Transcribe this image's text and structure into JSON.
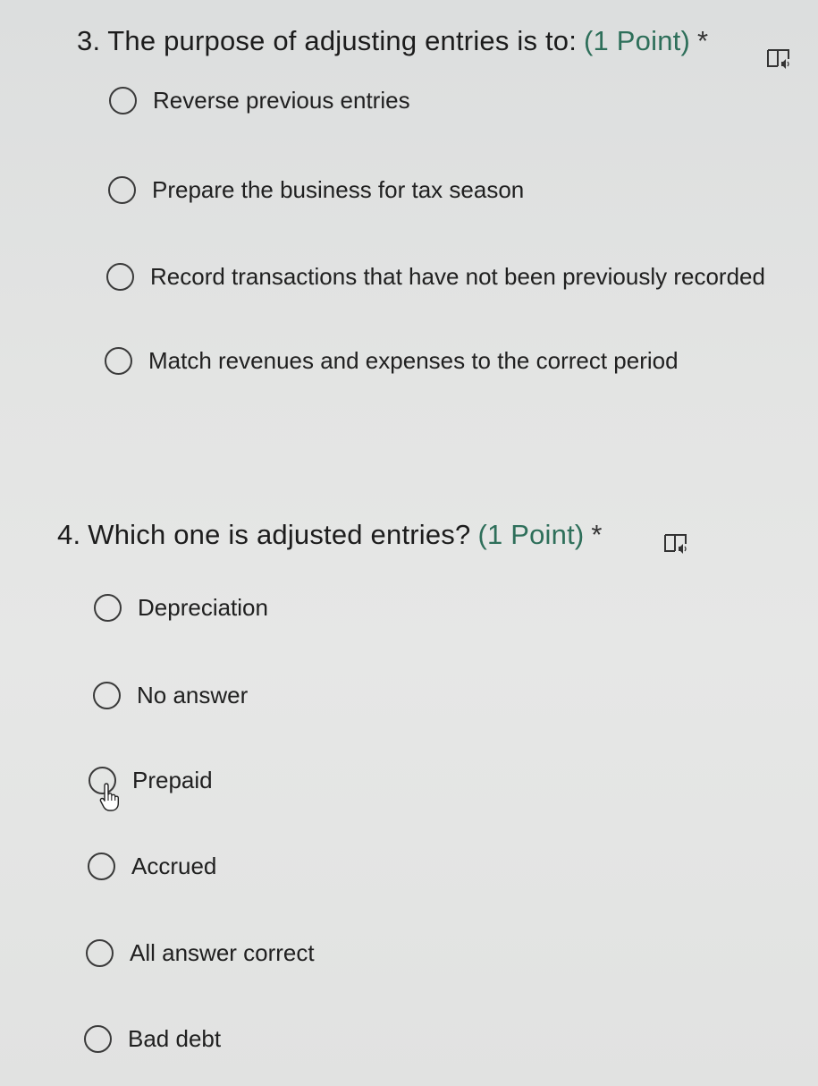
{
  "questions": [
    {
      "number": "3.",
      "title": "The purpose of adjusting entries is to:",
      "points": "(1 Point)",
      "required_marker": "*",
      "reader_icon": "immersive-reader-icon",
      "options": [
        {
          "label": "Reverse previous entries",
          "selected": false
        },
        {
          "label": "Prepare the business for tax season",
          "selected": false
        },
        {
          "label": "Record transactions that have not been previously recorded",
          "selected": false
        },
        {
          "label": "Match revenues and expenses to the correct period",
          "selected": false
        }
      ]
    },
    {
      "number": "4.",
      "title": "Which one is adjusted entries?",
      "points": "(1 Point)",
      "required_marker": "*",
      "reader_icon": "immersive-reader-icon",
      "options": [
        {
          "label": "Depreciation",
          "selected": false
        },
        {
          "label": "No answer",
          "selected": false
        },
        {
          "label": "Prepaid",
          "selected": false
        },
        {
          "label": "Accrued",
          "selected": false
        },
        {
          "label": "All answer correct",
          "selected": false
        },
        {
          "label": "Bad debt",
          "selected": false
        }
      ]
    }
  ],
  "pointer": {
    "icon": "hand-pointer-icon"
  }
}
